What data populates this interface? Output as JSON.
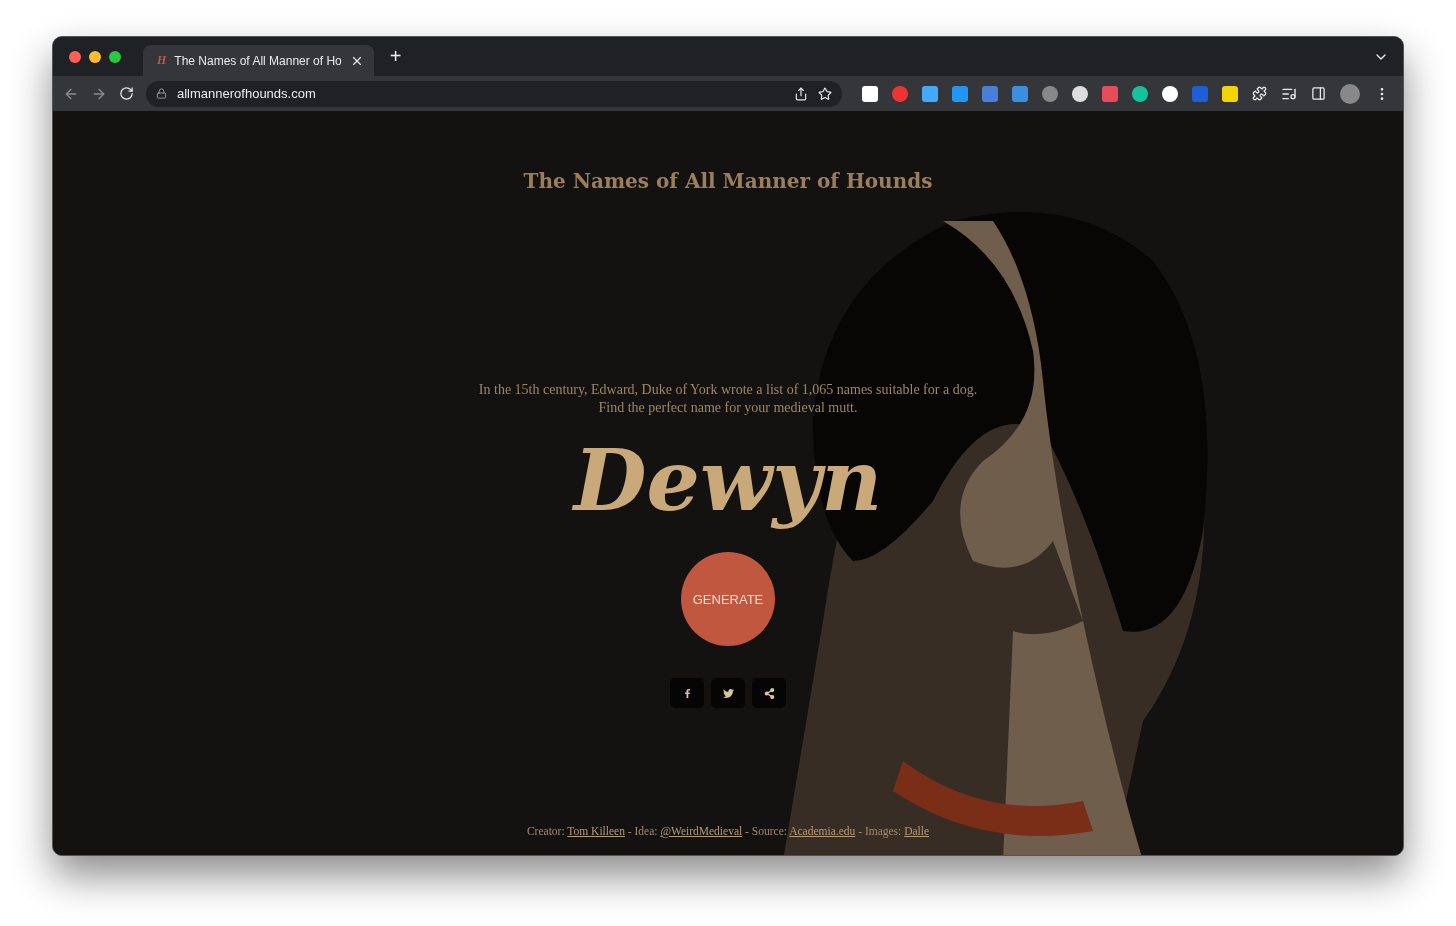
{
  "browser": {
    "tabs": [
      {
        "title": "The Names of All Manner of Ho",
        "favicon": "H",
        "selected": true
      }
    ],
    "new_tab": "+",
    "url": "allmannerofhounds.com"
  },
  "page": {
    "title": "The Names of All Manner of Hounds",
    "intro": [
      "In the 15th century, Edward, Duke of York wrote a list of 1,065 names suitable for a dog.",
      "Find the perfect name for your medieval mutt."
    ],
    "name": "Dewyn",
    "button": "GENERATE",
    "share": [
      {
        "kind": "facebook"
      },
      {
        "kind": "twitter"
      },
      {
        "kind": "share"
      }
    ],
    "credit_separator": "-",
    "credits": [
      {
        "label": "Creator:",
        "link": "Tom Killeen"
      },
      {
        "label": "Idea:",
        "link": "@WeirdMedieval"
      },
      {
        "label": "Source:",
        "link": "Academia.edu"
      },
      {
        "label": "Images:",
        "link": "Dalle"
      }
    ]
  }
}
